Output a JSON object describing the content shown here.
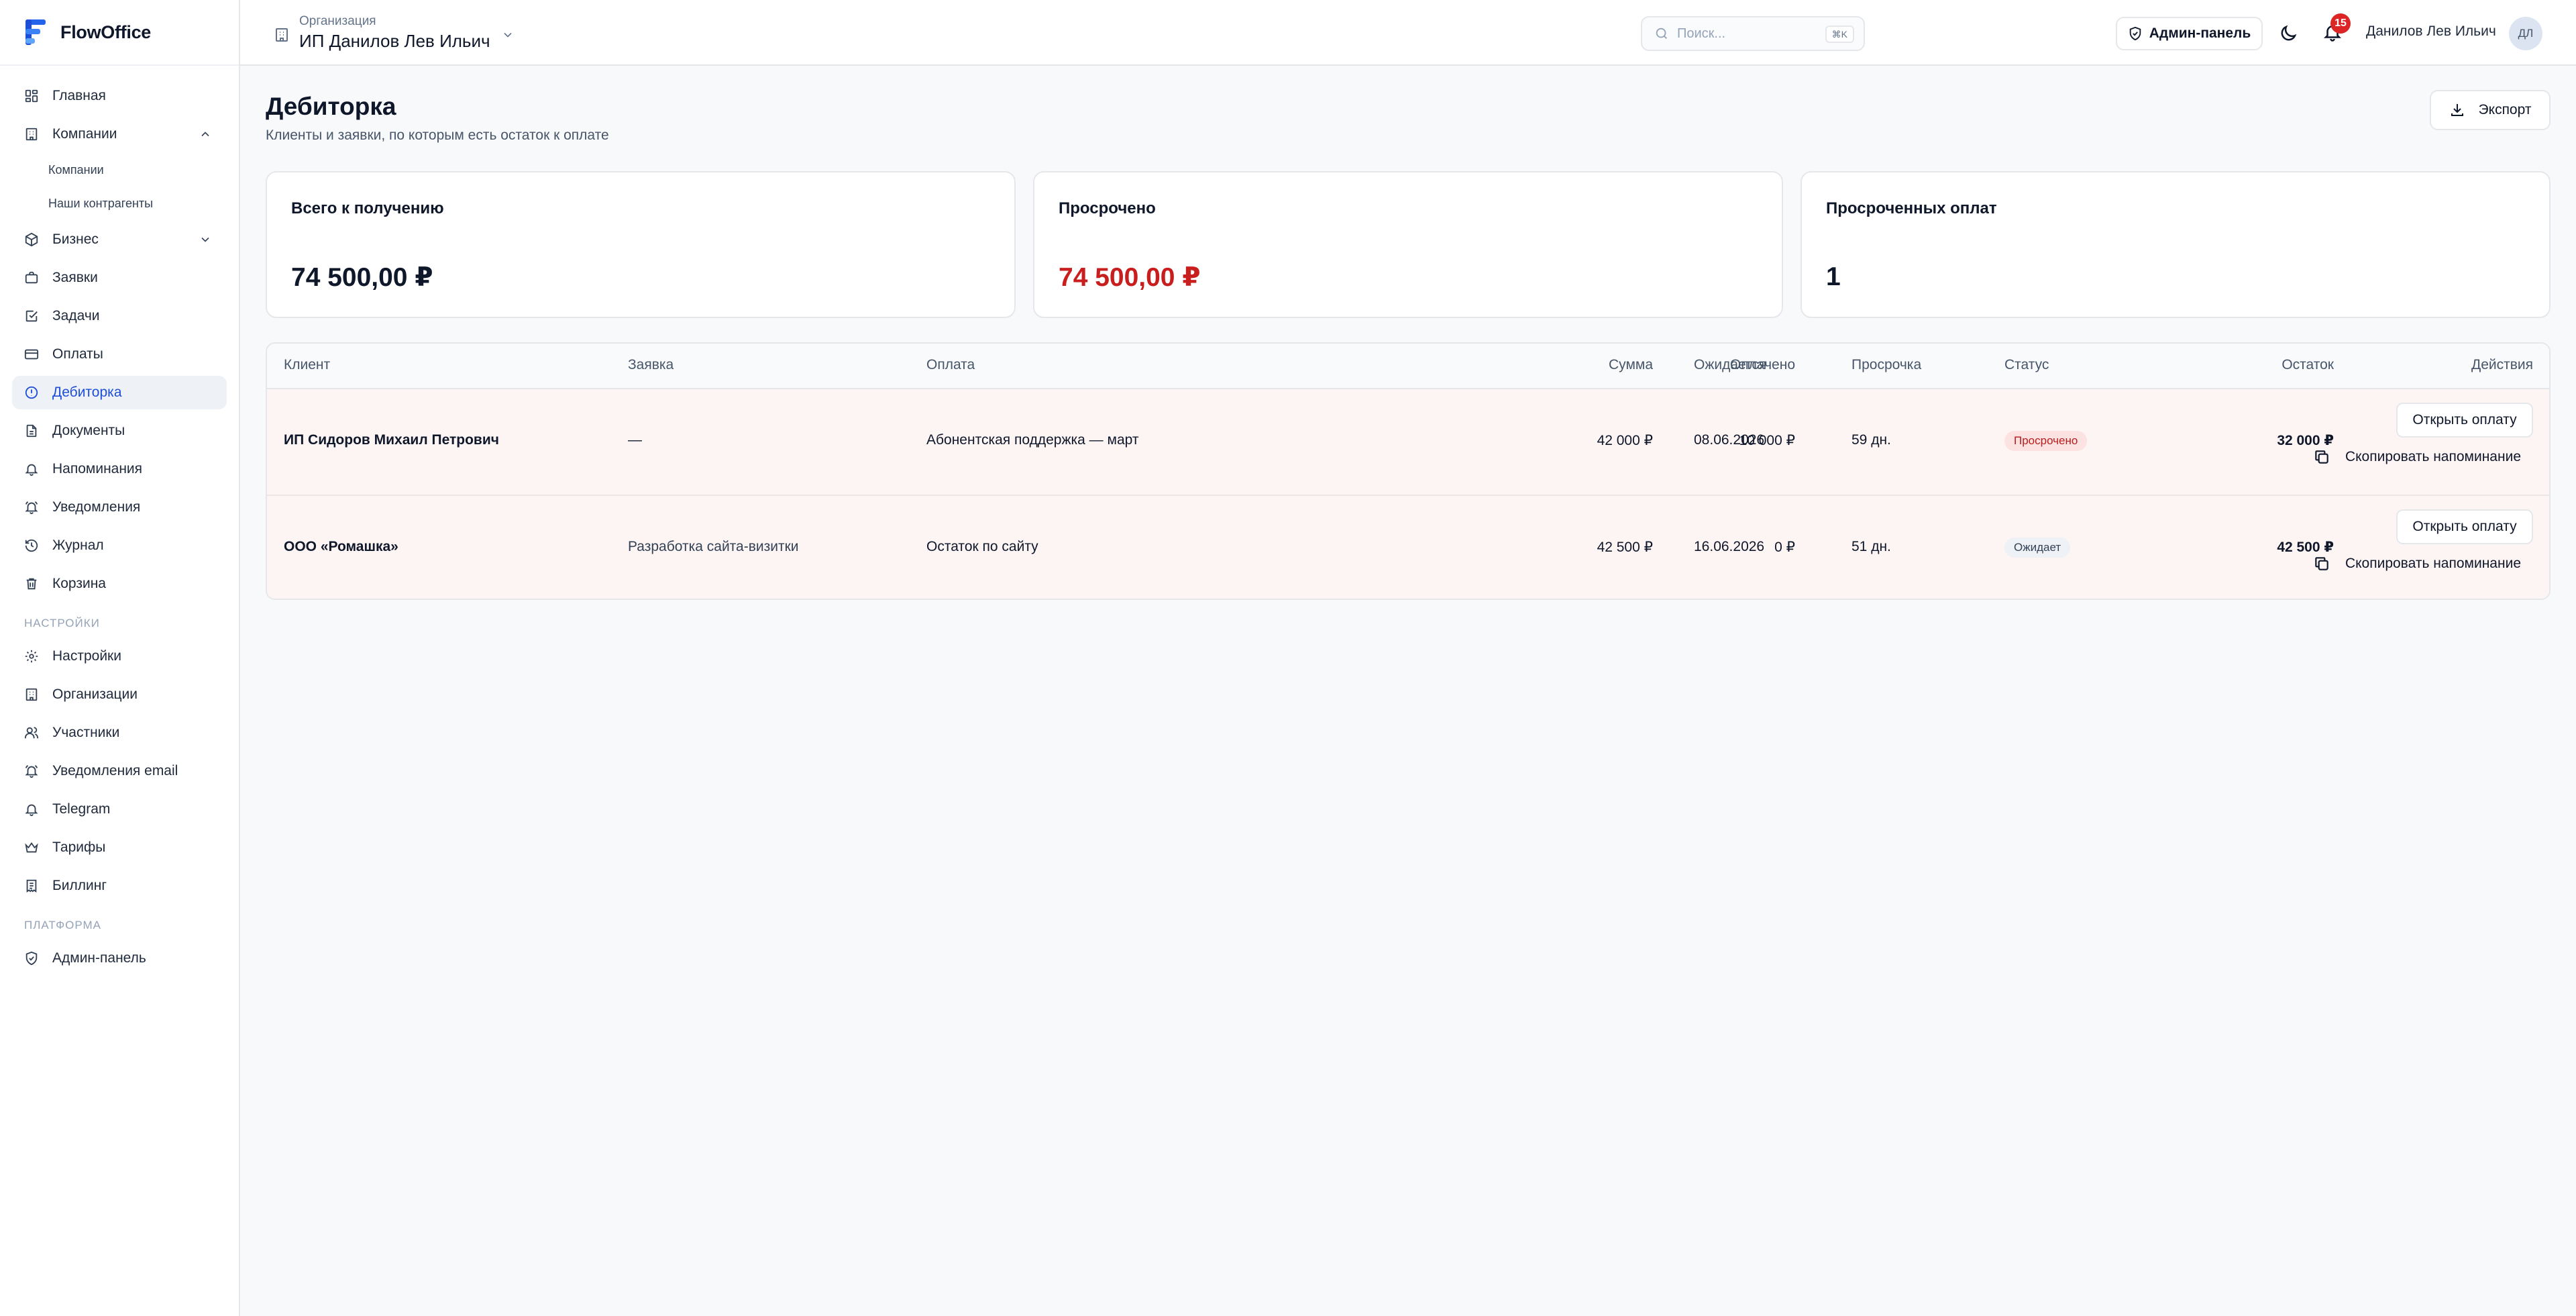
{
  "app": {
    "name": "FlowOffice"
  },
  "sidebar": {
    "items": [
      {
        "label": "Главная"
      },
      {
        "label": "Компании"
      },
      {
        "label": "Бизнес"
      },
      {
        "label": "Заявки"
      },
      {
        "label": "Задачи"
      },
      {
        "label": "Оплаты"
      },
      {
        "label": "Дебиторка"
      },
      {
        "label": "Документы"
      },
      {
        "label": "Напоминания"
      },
      {
        "label": "Уведомления"
      },
      {
        "label": "Журнал"
      },
      {
        "label": "Корзина"
      }
    ],
    "companies_sub": [
      "Компании",
      "Наши контрагенты"
    ],
    "settings_section": "НАСТРОЙКИ",
    "settings_items": [
      {
        "label": "Настройки"
      },
      {
        "label": "Организации"
      },
      {
        "label": "Участники"
      },
      {
        "label": "Уведомления email"
      },
      {
        "label": "Telegram"
      },
      {
        "label": "Тарифы"
      },
      {
        "label": "Биллинг"
      }
    ],
    "platform_section": "ПЛАТФОРМА",
    "platform_items": [
      {
        "label": "Админ-панель"
      }
    ]
  },
  "header": {
    "org_caption": "Организация",
    "org_name": "ИП Данилов Лев Ильич",
    "search_placeholder": "Поиск...",
    "search_shortcut": "⌘K",
    "admin_label": "Админ-панель",
    "notifications_count": "15",
    "user_name": "Данилов Лев Ильич",
    "user_initials": "ДЛ"
  },
  "page": {
    "title": "Дебиторка",
    "subtitle": "Клиенты и заявки, по которым есть остаток к оплате",
    "export_label": "Экспорт"
  },
  "cards": [
    {
      "label": "Всего к получению",
      "value": "74 500,00 ₽"
    },
    {
      "label": "Просрочено",
      "value": "74 500,00 ₽"
    },
    {
      "label": "Просроченных оплат",
      "value": "1"
    }
  ],
  "table": {
    "columns": [
      "Клиент",
      "Заявка",
      "Оплата",
      "Сумма",
      "Оплачено",
      "Остаток",
      "Ожидается",
      "Просрочка",
      "Статус",
      "Действия"
    ],
    "rows": [
      {
        "client": "ИП Сидоров Михаил Петрович",
        "request": "—",
        "payment": "Абонентская поддержка — март",
        "amount": "42 000 ₽",
        "paid": "10 000 ₽",
        "remaining": "32 000 ₽",
        "expected": "08.06.2026",
        "overdue": "59 дн.",
        "status": "Просрочено",
        "open_label": "Открыть оплату",
        "copy_label": "Скопировать напоминание"
      },
      {
        "client": "ООО «Ромашка»",
        "request": "Разработка сайта-визитки",
        "payment": "Остаток по сайту",
        "amount": "42 500 ₽",
        "paid": "0 ₽",
        "remaining": "42 500 ₽",
        "expected": "16.06.2026",
        "overdue": "51 дн.",
        "status": "Ожидает",
        "open_label": "Открыть оплату",
        "copy_label": "Скопировать напоминание"
      }
    ]
  },
  "colors": {
    "accent": "#1d4ed8",
    "danger": "#c81e1e",
    "row_tint": "#fdf4f4"
  }
}
